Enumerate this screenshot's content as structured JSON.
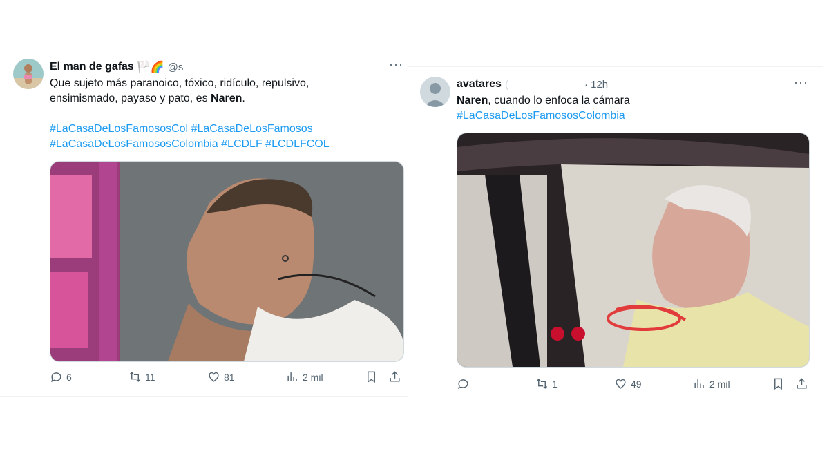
{
  "tweets": [
    {
      "display_name": "El man de gafas",
      "emoji": "🏳️🌈",
      "handle": "@s",
      "more": "···",
      "text_lines": [
        "Que sujeto más paranoico, tóxico, ridículo, repulsivo,",
        "ensimismado, payaso y pato, es "
      ],
      "bold_name": "Naren",
      "after_bold": ".",
      "hashtags_line1": [
        "#LaCasaDeLosFamososCol",
        "#LaCasaDeLosFamosos"
      ],
      "hashtags_line2": [
        "#LaCasaDeLosFamososColombia",
        "#LCDLF",
        "#LCDLFCOL"
      ],
      "replies": "6",
      "retweets": "11",
      "likes": "81",
      "views": "2 mil"
    },
    {
      "display_name": "avatares",
      "handle": "(",
      "time": "· 12h",
      "more": "···",
      "bold_name": "Naren",
      "after_bold": ", cuando lo enfoca la cámara",
      "hashtag": "#LaCasaDeLosFamososColombia",
      "replies": "",
      "retweets": "1",
      "likes": "49",
      "views": "2 mil"
    }
  ],
  "colors": {
    "link": "#1d9bf0",
    "muted": "#536471",
    "text": "#0f1419"
  }
}
